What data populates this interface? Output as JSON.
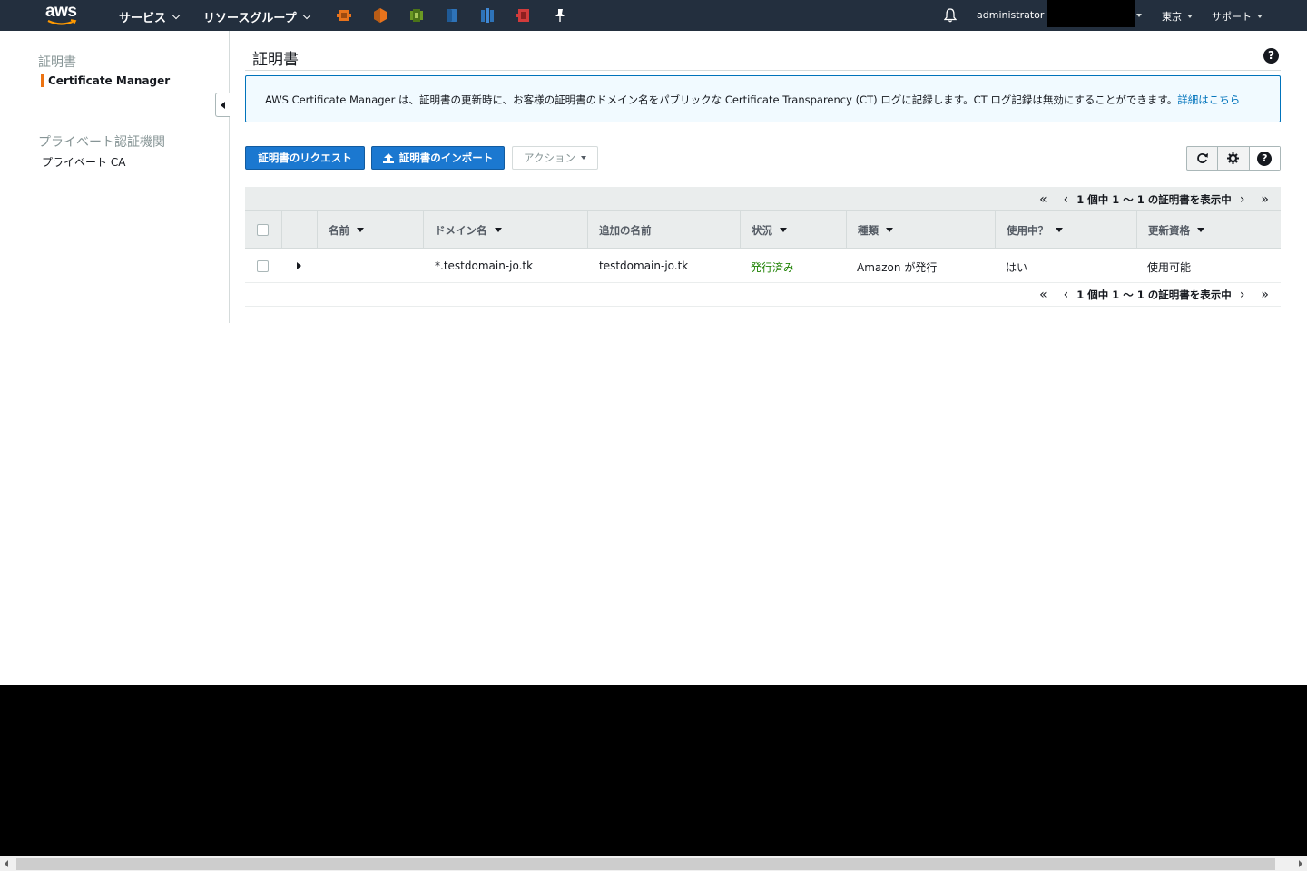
{
  "nav": {
    "logo_text": "aws",
    "services": "サービス",
    "resource_groups": "リソースグループ",
    "pinned_icons": [
      "ec2-icon",
      "lambda-icon",
      "cloudformation-icon",
      "rds-icon",
      "dynamodb-icon",
      "certificate-icon",
      "pin-icon"
    ],
    "user": "administrator @",
    "region": "東京",
    "support": "サポート"
  },
  "sidebar": {
    "section1": "証明書",
    "item1": "Certificate Manager",
    "section2": "プライベート認証機関",
    "item2": "プライベート CA"
  },
  "main": {
    "title": "証明書",
    "info_text": "AWS Certificate Manager は、証明書の更新時に、お客様の証明書のドメイン名をパブリックな Certificate Transparency (CT) ログに記録します。CT ログ記録は無効にすることができます。",
    "info_link": "詳細はこちら",
    "request_button": "証明書のリクエスト",
    "import_button": "証明書のインポート",
    "actions_button": "アクション",
    "pager_text": "1 個中 1 ～ 1 の証明書を表示中"
  },
  "table": {
    "columns": [
      "名前",
      "ドメイン名",
      "追加の名前",
      "状況",
      "種類",
      "使用中？",
      "更新資格"
    ],
    "rows": [
      {
        "name": "",
        "domain": "*.testdomain-jo.tk",
        "additional": "testdomain-jo.tk",
        "status": "発行済み",
        "type": "Amazon が発行",
        "in_use": "はい",
        "renewal": "使用可能"
      }
    ]
  },
  "colors": {
    "nav_bg": "#232f3e",
    "primary_button": "#1b78d0",
    "accent_orange": "#ec7211",
    "status_green": "#1d8102",
    "link_blue": "#0073bb"
  }
}
